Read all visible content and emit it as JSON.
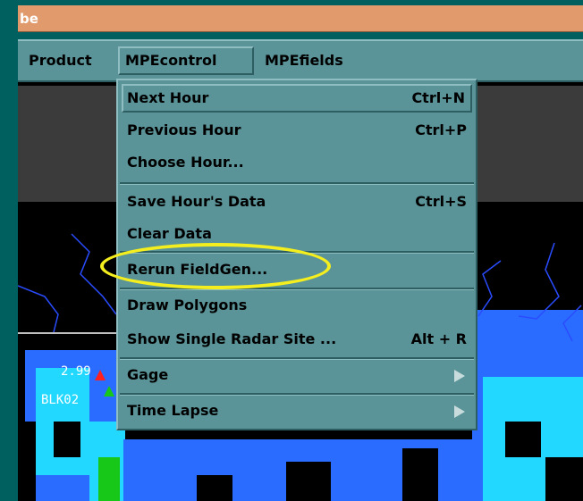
{
  "window": {
    "title_fragment": "be"
  },
  "menubar": {
    "items": [
      {
        "label": "Product"
      },
      {
        "label": "MPEcontrol"
      },
      {
        "label": "MPEfields"
      }
    ]
  },
  "dropdown": {
    "items": [
      {
        "label": "Next Hour",
        "accel": "Ctrl+N"
      },
      {
        "label": "Previous Hour",
        "accel": "Ctrl+P"
      },
      {
        "label": "Choose Hour..."
      },
      {
        "label": "Save Hour's Data",
        "accel": "Ctrl+S"
      },
      {
        "label": "Clear Data"
      },
      {
        "label": "Rerun FieldGen..."
      },
      {
        "label": "Draw Polygons"
      },
      {
        "label": "Show Single Radar Site ...",
        "accel": "Alt + R"
      },
      {
        "label": "Gage"
      },
      {
        "label": "Time Lapse"
      }
    ]
  },
  "map": {
    "gage_value": "2.99",
    "gage_id": "BLK02"
  },
  "colors": {
    "background": "#005f5f",
    "titlebar": "#e09a6c",
    "menu": "#5a9498",
    "highlight_ellipse": "#f5ee1e",
    "map_dark": "#3a3a3a",
    "precip_blue": "#2a6cff",
    "precip_cyan": "#22d8ff",
    "precip_green": "#18c818"
  },
  "icons": {
    "cascade": "right-triangle-icon"
  }
}
